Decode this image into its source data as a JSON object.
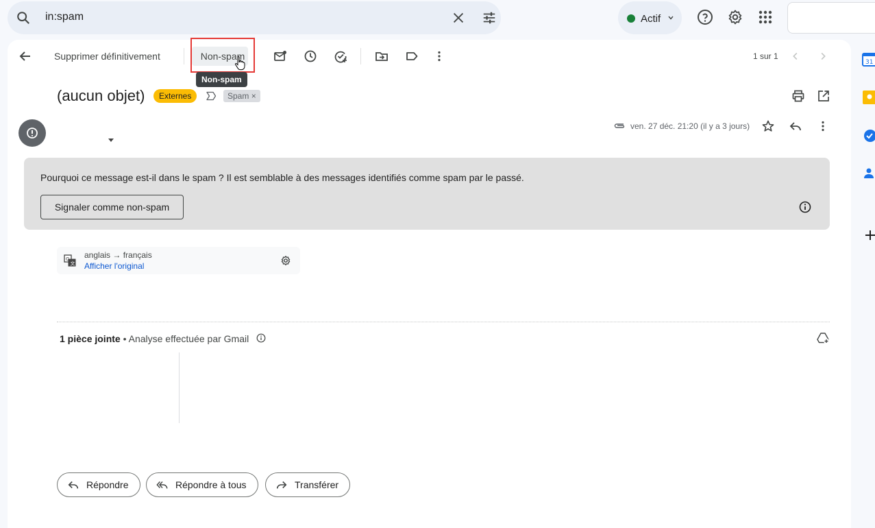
{
  "search": {
    "query": "in:spam"
  },
  "status": {
    "label": "Actif",
    "color": "#188038"
  },
  "toolbar": {
    "delete_forever": "Supprimer définitivement",
    "not_spam": "Non-spam",
    "tooltip": "Non-spam",
    "pager": "1 sur 1"
  },
  "message": {
    "subject": "(aucun objet)",
    "label_external": "Externes",
    "label_spam": "Spam",
    "label_spam_remove": "×",
    "date": "ven. 27 déc. 21:20 (il y a 3 jours)"
  },
  "spam_notice": {
    "question": "Pourquoi ce message est-il dans le spam ?",
    "reason": " Il est semblable à des messages identifiés comme spam par le passé.",
    "report_button": "Signaler comme non-spam"
  },
  "translation": {
    "languages": "anglais → français",
    "show_original": "Afficher l'original"
  },
  "attachments": {
    "count_label": "1 pièce jointe",
    "scan_label": " • Analyse effectuée par Gmail"
  },
  "actions": {
    "reply": "Répondre",
    "reply_all": "Répondre à tous",
    "forward": "Transférer"
  },
  "colors": {
    "external_label": "#fbbc04",
    "highlight": "#e53935",
    "link": "#0b57d0"
  }
}
